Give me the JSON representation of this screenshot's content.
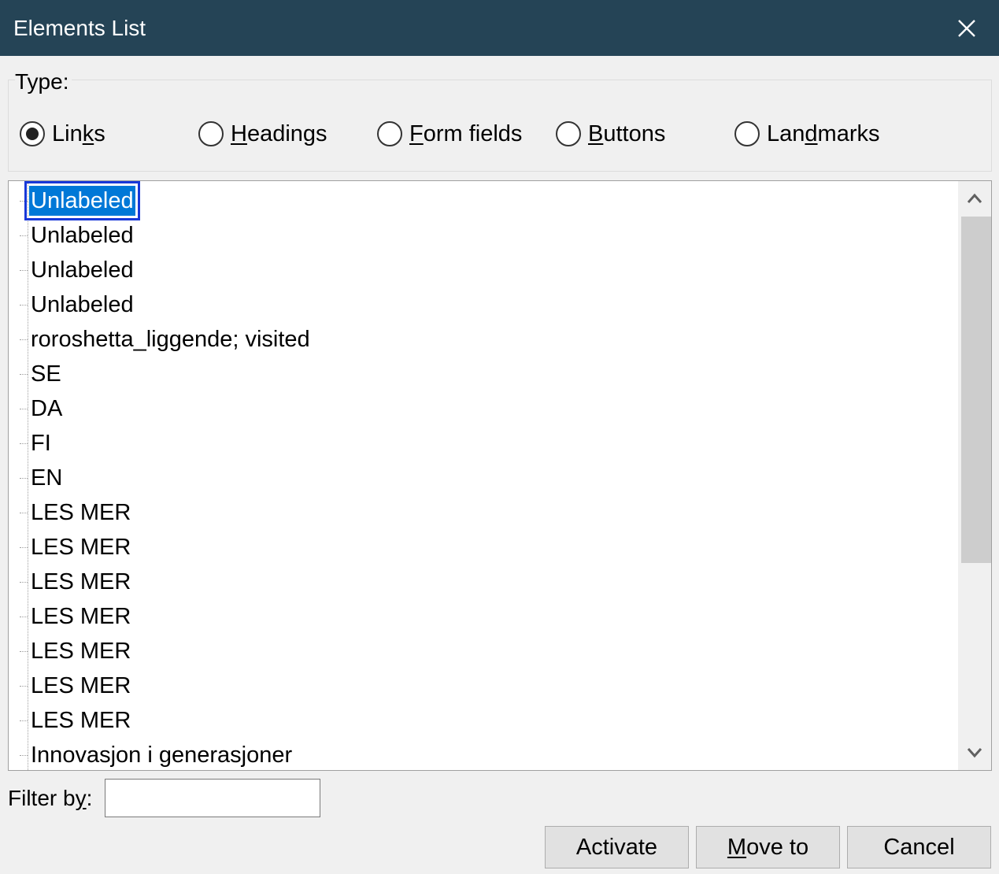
{
  "window": {
    "title": "Elements List",
    "close_icon": "close-icon"
  },
  "type_group": {
    "label": "Type:",
    "options": [
      {
        "pre": "Lin",
        "acc": "k",
        "post": "s",
        "checked": true
      },
      {
        "pre": "",
        "acc": "H",
        "post": "eadings",
        "checked": false
      },
      {
        "pre": "",
        "acc": "F",
        "post": "orm fields",
        "checked": false
      },
      {
        "pre": "",
        "acc": "B",
        "post": "uttons",
        "checked": false
      },
      {
        "pre": "Lan",
        "acc": "d",
        "post": "marks",
        "checked": false
      }
    ]
  },
  "list": {
    "items": [
      "Unlabeled",
      "Unlabeled",
      "Unlabeled",
      "Unlabeled",
      "roroshetta_liggende; visited",
      "SE",
      "DA",
      "FI",
      "EN",
      "LES MER",
      "LES MER",
      "LES MER",
      "LES MER",
      "LES MER",
      "LES MER",
      "LES MER",
      "Innovasjon i generasjoner"
    ],
    "selected_index": 0
  },
  "filter": {
    "pre": "Filter b",
    "acc": "y",
    "post": ":",
    "value": ""
  },
  "buttons": {
    "activate": {
      "label": "Activate"
    },
    "move_to": {
      "pre": "",
      "acc": "M",
      "post": "ove to"
    },
    "cancel": {
      "label": "Cancel"
    }
  },
  "colors": {
    "titlebar": "#254456",
    "selection": "#0078d7",
    "focus_ring": "#1838d8"
  }
}
